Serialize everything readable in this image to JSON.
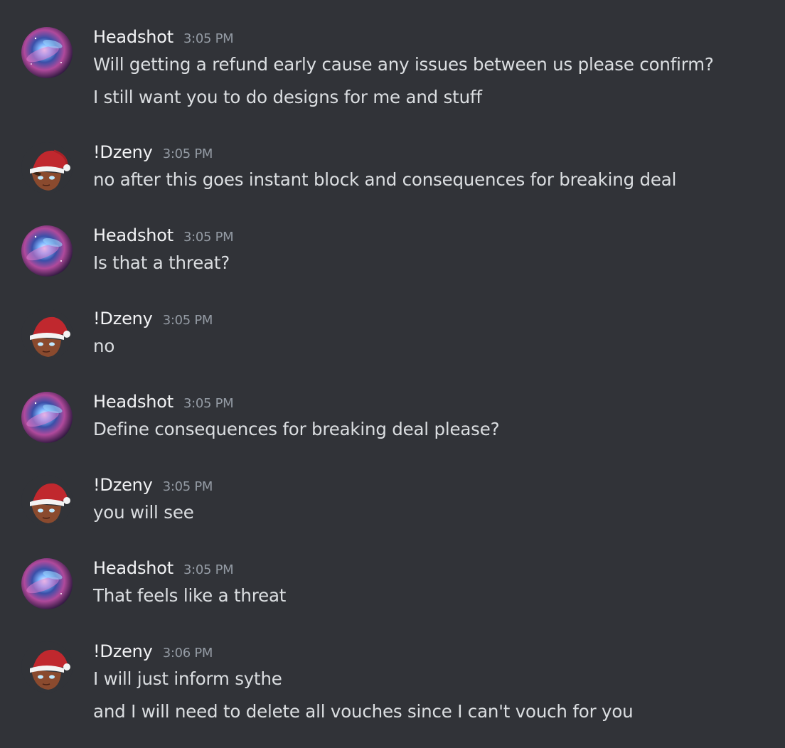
{
  "messages": [
    {
      "author": "Headshot",
      "avatar_icon": "galaxy-avatar-icon",
      "timestamp": "3:05 PM",
      "lines": [
        "Will getting a refund early cause any issues between us please confirm?",
        "I still want you to do designs for me and stuff"
      ]
    },
    {
      "author": "!Dzeny",
      "avatar_icon": "santa-hat-avatar-icon",
      "timestamp": "3:05 PM",
      "lines": [
        "no after this goes instant block and consequences for breaking deal"
      ]
    },
    {
      "author": "Headshot",
      "avatar_icon": "galaxy-avatar-icon",
      "timestamp": "3:05 PM",
      "lines": [
        "Is that a threat?"
      ]
    },
    {
      "author": "!Dzeny",
      "avatar_icon": "santa-hat-avatar-icon",
      "timestamp": "3:05 PM",
      "lines": [
        "no"
      ]
    },
    {
      "author": "Headshot",
      "avatar_icon": "galaxy-avatar-icon",
      "timestamp": "3:05 PM",
      "lines": [
        "Define consequences for breaking deal please?"
      ]
    },
    {
      "author": "!Dzeny",
      "avatar_icon": "santa-hat-avatar-icon",
      "timestamp": "3:05 PM",
      "lines": [
        "you will see"
      ]
    },
    {
      "author": "Headshot",
      "avatar_icon": "galaxy-avatar-icon",
      "timestamp": "3:05 PM",
      "lines": [
        "That feels like a threat"
      ]
    },
    {
      "author": "!Dzeny",
      "avatar_icon": "santa-hat-avatar-icon",
      "timestamp": "3:06 PM",
      "lines": [
        "I will just inform sythe",
        "and I will need to delete all vouches since I can't vouch for you"
      ]
    }
  ],
  "colors": {
    "background": "#313338",
    "username": "#f2f3f5",
    "message_text": "#dbdee1",
    "timestamp": "#949ba4"
  }
}
